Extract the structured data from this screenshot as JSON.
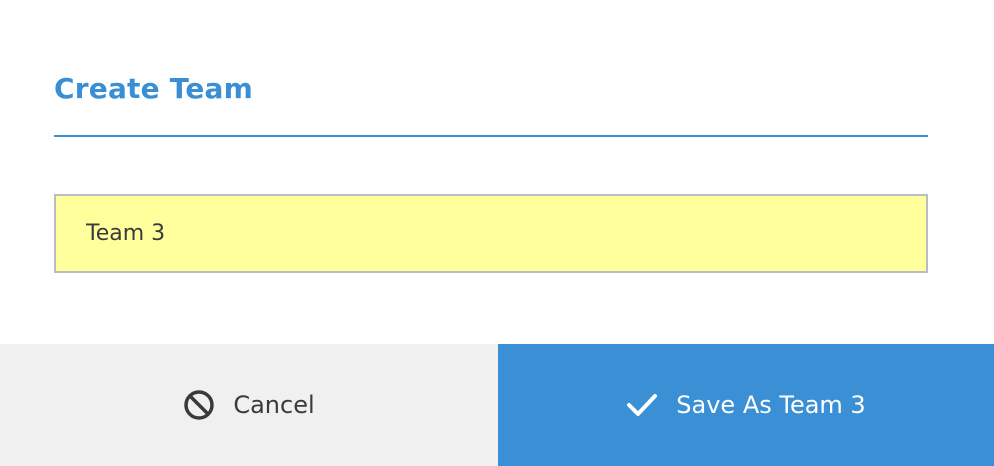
{
  "dialog": {
    "title": "Create Team"
  },
  "name_field": {
    "value": "Team 3"
  },
  "footer": {
    "cancel_label": "Cancel",
    "cancel_icon": "ban-icon",
    "save_label": "Save As Team 3",
    "save_icon": "check-icon"
  },
  "colors": {
    "accent": "#3a8fd4",
    "input_background": "#ffff9c",
    "cancel_background": "#eff0ef",
    "save_background": "#3b90d5"
  }
}
